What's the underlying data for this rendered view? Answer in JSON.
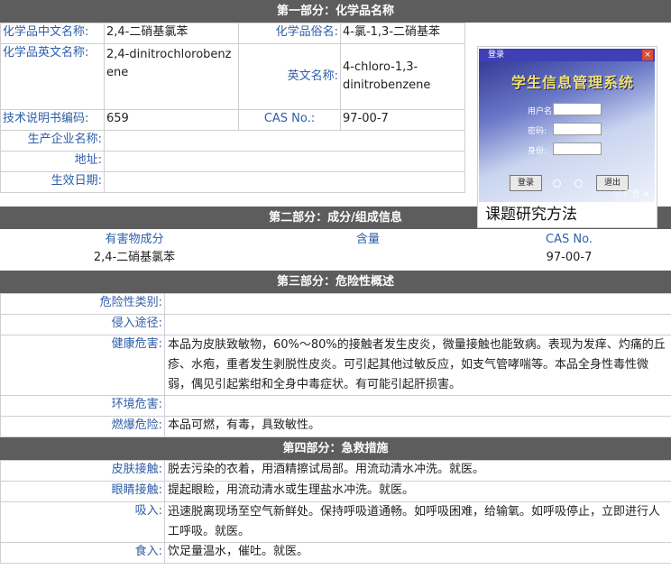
{
  "section1": {
    "header": "第一部分：化学品名称",
    "labels": {
      "cn_name": "化学品中文名称:",
      "common_name": "化学品俗名:",
      "en_name": "化学品英文名称:",
      "en_name2": "英文名称:",
      "code": "技术说明书编码:",
      "cas": "CAS No.:",
      "maker": "生产企业名称:",
      "address": "地址:",
      "effective": "生效日期:"
    },
    "values": {
      "cn_name": "2,4-二硝基氯苯",
      "common_name": "4-氯-1,3-二硝基苯",
      "en_name": "2,4-dinitrochlorobenzene",
      "en_name2": "4-chloro-1,3-dinitrobenzene",
      "code": "659",
      "cas": "97-00-7",
      "maker": "",
      "address": "",
      "effective": ""
    }
  },
  "ad": {
    "window_title": "登录",
    "close": "×",
    "headline": "学生信息管理系统",
    "field_user": "用户名:",
    "field_pass": "密码:",
    "field_role": "身份:",
    "btn_login": "登录",
    "btn_exit": "退出",
    "tag": "广告",
    "caption": "课题研究方法"
  },
  "section2": {
    "header": "第二部分：成分/组成信息",
    "col_hazard": "有害物成分",
    "col_content": "含量",
    "col_cas": "CAS No.",
    "row": {
      "hazard": "2,4-二硝基氯苯",
      "content": "",
      "cas": "97-00-7"
    }
  },
  "section3": {
    "header": "第三部分：危险性概述",
    "rows": [
      {
        "label": "危险性类别:",
        "value": ""
      },
      {
        "label": "侵入途径:",
        "value": ""
      },
      {
        "label": "健康危害:",
        "value": "本品为皮肤致敏物，60%～80%的接触者发生皮炎，微量接触也能致病。表现为发痒、灼痛的丘疹、水疱，重者发生剥脱性皮炎。可引起其他过敏反应，如支气管哮喘等。本品全身性毒性微弱，偶见引起紫绀和全身中毒症状。有可能引起肝损害。"
      },
      {
        "label": "环境危害:",
        "value": ""
      },
      {
        "label": "燃爆危险:",
        "value": "本品可燃，有毒，具致敏性。"
      }
    ]
  },
  "section4": {
    "header": "第四部分：急救措施",
    "rows": [
      {
        "label": "皮肤接触:",
        "value": "脱去污染的衣着，用酒精擦试局部。用流动清水冲洗。就医。"
      },
      {
        "label": "眼睛接触:",
        "value": "提起眼睑，用流动清水或生理盐水冲洗。就医。"
      },
      {
        "label": "吸入:",
        "value": "迅速脱离现场至空气新鲜处。保持呼吸道通畅。如呼吸困难，给输氧。如呼吸停止，立即进行人工呼吸。就医。"
      },
      {
        "label": "食入:",
        "value": "饮足量温水，催吐。就医。"
      }
    ]
  }
}
